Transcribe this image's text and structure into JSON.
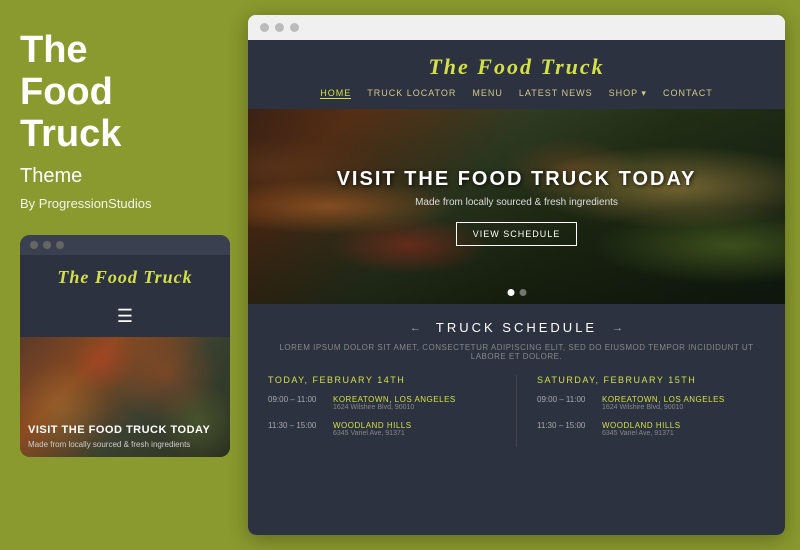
{
  "left": {
    "title_line1": "The",
    "title_line2": "Food",
    "title_line3": "Truck",
    "subtitle": "Theme",
    "author": "By ProgressionStudios",
    "mobile": {
      "site_title": "The Food Truck",
      "hero_heading": "VISIT THE FOOD TRUCK TODAY",
      "hero_sub": "Made from locally sourced & fresh ingredients"
    }
  },
  "desktop": {
    "browser_dots": [
      "dot1",
      "dot2",
      "dot3"
    ],
    "header": {
      "logo": "The Food Truck",
      "nav": [
        {
          "label": "Home",
          "active": true
        },
        {
          "label": "Truck Locator",
          "active": false
        },
        {
          "label": "Menu",
          "active": false
        },
        {
          "label": "Latest News",
          "active": false
        },
        {
          "label": "Shop",
          "active": false,
          "dropdown": true
        },
        {
          "label": "Contact",
          "active": false
        }
      ]
    },
    "hero": {
      "title": "Visit The Food Truck Today",
      "subtitle": "Made from locally sourced & fresh ingredients",
      "cta": "View Schedule"
    },
    "schedule": {
      "section_title": "Truck Schedule",
      "description": "Lorem ipsum dolor sit amet, consectetur adipiscing elit, sed do eiusmod tempor incididunt ut labore et dolore.",
      "days": [
        {
          "day_label": "Today, February 14th",
          "items": [
            {
              "time": "09:00 – 11:00",
              "location": "Koreatown, Los Angeles",
              "address": "1624 Wilshire Blvd, 90010"
            },
            {
              "time": "11:30 – 15:00",
              "location": "Woodland Hills",
              "address": "6345 Variel Ave, 91371"
            }
          ]
        },
        {
          "day_label": "Saturday, February 15th",
          "items": [
            {
              "time": "09:00 – 11:00",
              "location": "Koreatown, Los Angeles",
              "address": "1624 Wilshire Blvd, 90010"
            },
            {
              "time": "11:30 – 15:00",
              "location": "Woodland Hills",
              "address": "6345 Variel Ave, 91371"
            }
          ]
        }
      ]
    }
  }
}
